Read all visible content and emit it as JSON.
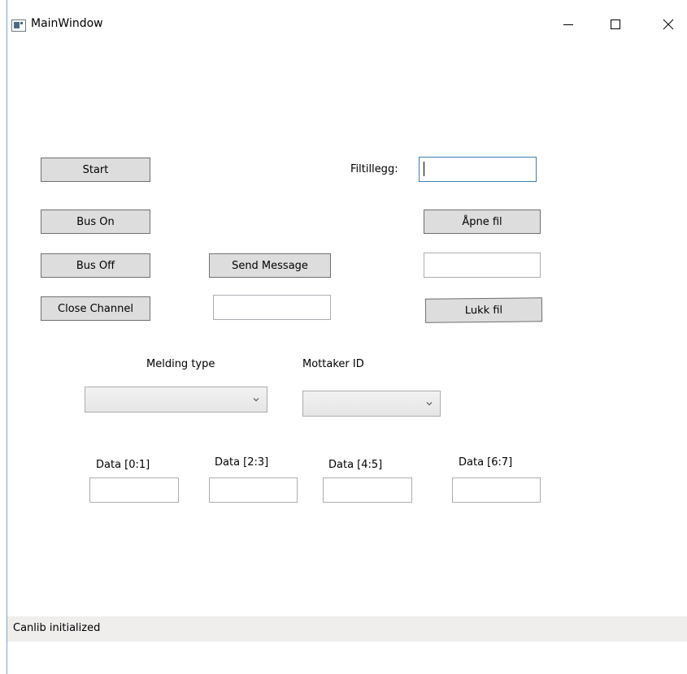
{
  "window": {
    "title": "MainWindow",
    "controls": {
      "minimize": "minimize",
      "maximize": "maximize",
      "close": "close"
    }
  },
  "buttons": {
    "start": "Start",
    "bus_on": "Bus On",
    "bus_off": "Bus Off",
    "close_channel": "Close Channel",
    "send_message": "Send Message",
    "open_file": "Åpne fil",
    "close_file": "Lukk fil"
  },
  "labels": {
    "file_suffix": "Filtillegg:",
    "message_type": "Melding type",
    "receiver_id": "Mottaker ID",
    "data_0_1": "Data [0:1]",
    "data_2_3": "Data [2:3]",
    "data_4_5": "Data [4:5]",
    "data_6_7": "Data [6:7]"
  },
  "inputs": {
    "file_suffix": "",
    "file_path": "",
    "message": "",
    "data_0_1": "",
    "data_2_3": "",
    "data_4_5": "",
    "data_6_7": ""
  },
  "combos": {
    "message_type_selected": "",
    "receiver_id_selected": ""
  },
  "icons": {
    "app": "app-window-icon",
    "combo_arrow": "chevron-down-icon"
  },
  "colors": {
    "button_bg": "#dddddd",
    "button_border": "#707070",
    "focus_border": "#3c7fb1",
    "status_bg": "#f0eded"
  },
  "status": {
    "text": "Canlib initialized"
  }
}
